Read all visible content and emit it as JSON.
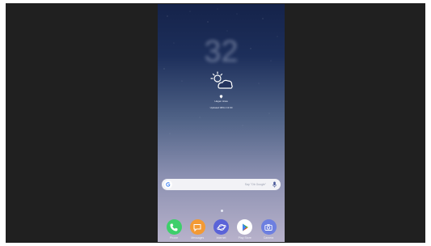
{
  "lockscreen": {
    "temperature": "32",
    "weather_icon": "partly-cloudy-icon",
    "location_icon": "location-pin-icon",
    "city": "Hagen Hiwa",
    "updated": "Updated 08/11 13:00"
  },
  "search_bar": {
    "placeholder": "Say \"Ok Google\"",
    "icon": "google-g-icon",
    "mic_icon": "mic-icon"
  },
  "dock": {
    "apps": [
      {
        "label": "Phone",
        "icon": "phone-icon",
        "color": "#3ecf6b"
      },
      {
        "label": "Messages",
        "icon": "messages-icon",
        "color": "#f39a35"
      },
      {
        "label": "Internet",
        "icon": "internet-icon",
        "color": "#5a63d8"
      },
      {
        "label": "Play Store",
        "icon": "play-store-icon",
        "color": "#ffffff"
      },
      {
        "label": "Camera",
        "icon": "camera-icon",
        "color": "#6d7fe0"
      }
    ]
  },
  "colors": {
    "frame": "#202020",
    "wallpaper_top": "#15234a",
    "wallpaper_bottom": "#b8b2cb"
  }
}
